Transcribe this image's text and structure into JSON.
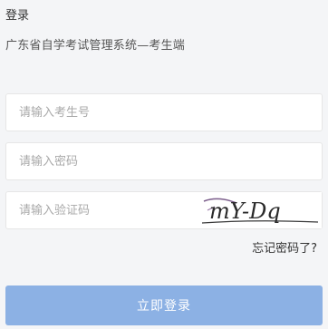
{
  "header": {
    "title": "登录",
    "subtitle": "广东省自学考试管理系统—考生端"
  },
  "form": {
    "student_id": {
      "value": "",
      "placeholder": "请输入考生号"
    },
    "password": {
      "value": "",
      "placeholder": "请输入密码"
    },
    "captcha": {
      "value": "",
      "placeholder": "请输入验证码",
      "image_text": "mY-Dq"
    },
    "forgot_password_label": "忘记密码了?",
    "submit_label": "立即登录"
  },
  "colors": {
    "button_bg": "#8cb1e4",
    "page_bg": "#f4f5f7",
    "captcha_text": "#2a2a2a",
    "captcha_accent": "#7a5c8a"
  }
}
